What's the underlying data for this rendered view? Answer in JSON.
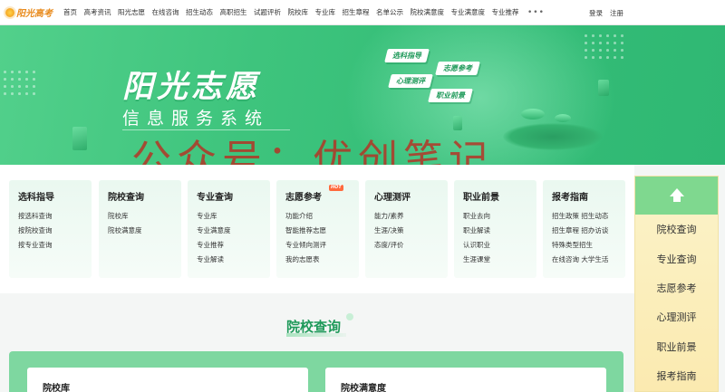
{
  "logo": {
    "text": "阳光高考"
  },
  "nav": {
    "links": [
      "首页",
      "高考资讯",
      "阳光志愿",
      "在线咨询",
      "招生动态",
      "高职招生",
      "试题评析",
      "院校库",
      "专业库",
      "招生章程",
      "名单公示",
      "院校满意度",
      "专业满意度",
      "专业推荐"
    ],
    "more": "•••",
    "login": "登录",
    "register": "注册"
  },
  "banner": {
    "title": "阳光志愿",
    "subtitle": "信息服务系统",
    "chips": [
      "选科指导",
      "志愿参考",
      "心理测评",
      "职业前景"
    ],
    "watermark": "公众号：优创笔记"
  },
  "categories": [
    {
      "title": "选科指导",
      "hot": "",
      "items": [
        "按选科查询",
        "按院校查询",
        "按专业查询"
      ]
    },
    {
      "title": "院校查询",
      "hot": "",
      "items": [
        "院校库",
        "院校满意度"
      ]
    },
    {
      "title": "专业查询",
      "hot": "",
      "items": [
        "专业库",
        "专业满意度",
        "专业推荐",
        "专业解读"
      ]
    },
    {
      "title": "志愿参考",
      "hot": "HOT",
      "items": [
        "功能介绍",
        "智能推荐志愿",
        "专业倾向测评",
        "我的志愿表"
      ]
    },
    {
      "title": "心理测评",
      "hot": "",
      "items": [
        "能力/素养",
        "生涯/决策",
        "态度/评价"
      ]
    },
    {
      "title": "职业前景",
      "hot": "",
      "items": [
        "职业去向",
        "职业解读",
        "认识职业",
        "生涯课堂"
      ]
    },
    {
      "title": "报考指南",
      "hot": "",
      "items": [
        "招生政策  招生动态",
        "招生章程  招办访谈",
        "特殊类型招生",
        "在线咨询  大学生活"
      ]
    }
  ],
  "sidebar": {
    "items": [
      "院校查询",
      "专业查询",
      "志愿参考",
      "心理测评",
      "职业前景",
      "报考指南"
    ]
  },
  "section": {
    "title": "院校查询",
    "cards": [
      "院校库",
      "院校满意度"
    ]
  },
  "colors": {
    "brand_green": "#3ec47d",
    "accent_green": "#1f9a5a",
    "watermark_red": "#be281e",
    "sidebar_yellow": "#fbeab0",
    "logo_orange": "#e8891a"
  }
}
